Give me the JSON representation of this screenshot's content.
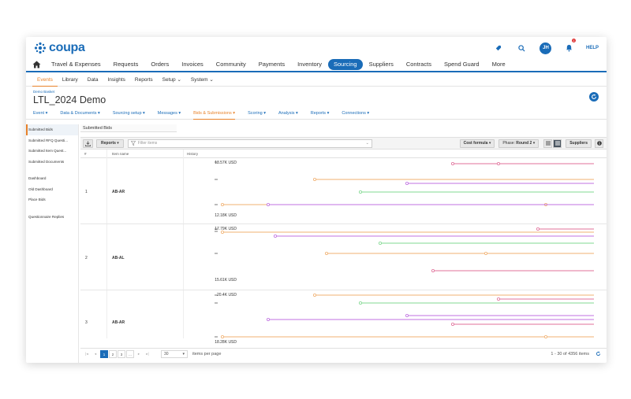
{
  "brand": {
    "name": "coupa",
    "color": "#1a6cb8"
  },
  "topbar": {
    "avatar_initials": "JH",
    "help_label": "HELP",
    "notification_count": "1"
  },
  "main_nav": [
    "Travel & Expenses",
    "Requests",
    "Orders",
    "Invoices",
    "Community",
    "Payments",
    "Inventory",
    "Sourcing",
    "Suppliers",
    "Contracts",
    "Spend Guard",
    "More"
  ],
  "main_nav_active": "Sourcing",
  "sub_nav": [
    "Events",
    "Library",
    "Data",
    "Insights",
    "Reports",
    "Setup ⌄",
    "System ⌄"
  ],
  "sub_nav_active": "Events",
  "breadcrumb": "Demo Basket",
  "page_title": "LTL_2024 Demo",
  "event_tabs": [
    "Event ▾",
    "Data & Documents ▾",
    "Sourcing setup ▾",
    "Messages ▾",
    "Bids & Submissions ▾",
    "Scoring ▾",
    "Analysis ▾",
    "Reports ▾",
    "Connections ▾"
  ],
  "event_tab_active": "Bids & Submissions ▾",
  "sidebar": {
    "group1": [
      "Submitted Bids",
      "Submitted RFQ Questi...",
      "Submitted Item Quest...",
      "Submitted Documents"
    ],
    "group2": [
      "Dashboard",
      "Old Dashboard",
      "Place Bids"
    ],
    "group3": [
      "Questionnaire Replies"
    ],
    "active": "Submitted Bids"
  },
  "content_tab": "Submitted Bids",
  "toolbar": {
    "reports_label": "Reports",
    "filter_placeholder": "Filter items",
    "cost_formula_label": "Cost formula",
    "phase_label": "Phase:",
    "phase_value": "Round 2",
    "suppliers_label": "Suppliers"
  },
  "table_headers": {
    "index": "#",
    "name": "Item name",
    "history": "History"
  },
  "rows": [
    {
      "index": "1",
      "name": "AB-AR",
      "max": "13.57K USD",
      "min": "12.18K USD"
    },
    {
      "index": "2",
      "name": "AB-AL",
      "max": "17.79K USD",
      "min": "15.61K USD"
    },
    {
      "index": "3",
      "name": "AB-AR",
      "max": "20.4K USD",
      "min": "18.28K USD"
    }
  ],
  "series_colors": {
    "pink": "#e0709a",
    "orange": "#f0b070",
    "purple": "#c070e0",
    "green": "#80d890"
  },
  "pager": {
    "pages": [
      "1",
      "2",
      "3",
      "..."
    ],
    "current": "1",
    "per_page": "30",
    "per_page_label": "items per page",
    "count_text": "1 - 30 of 4356 items"
  }
}
